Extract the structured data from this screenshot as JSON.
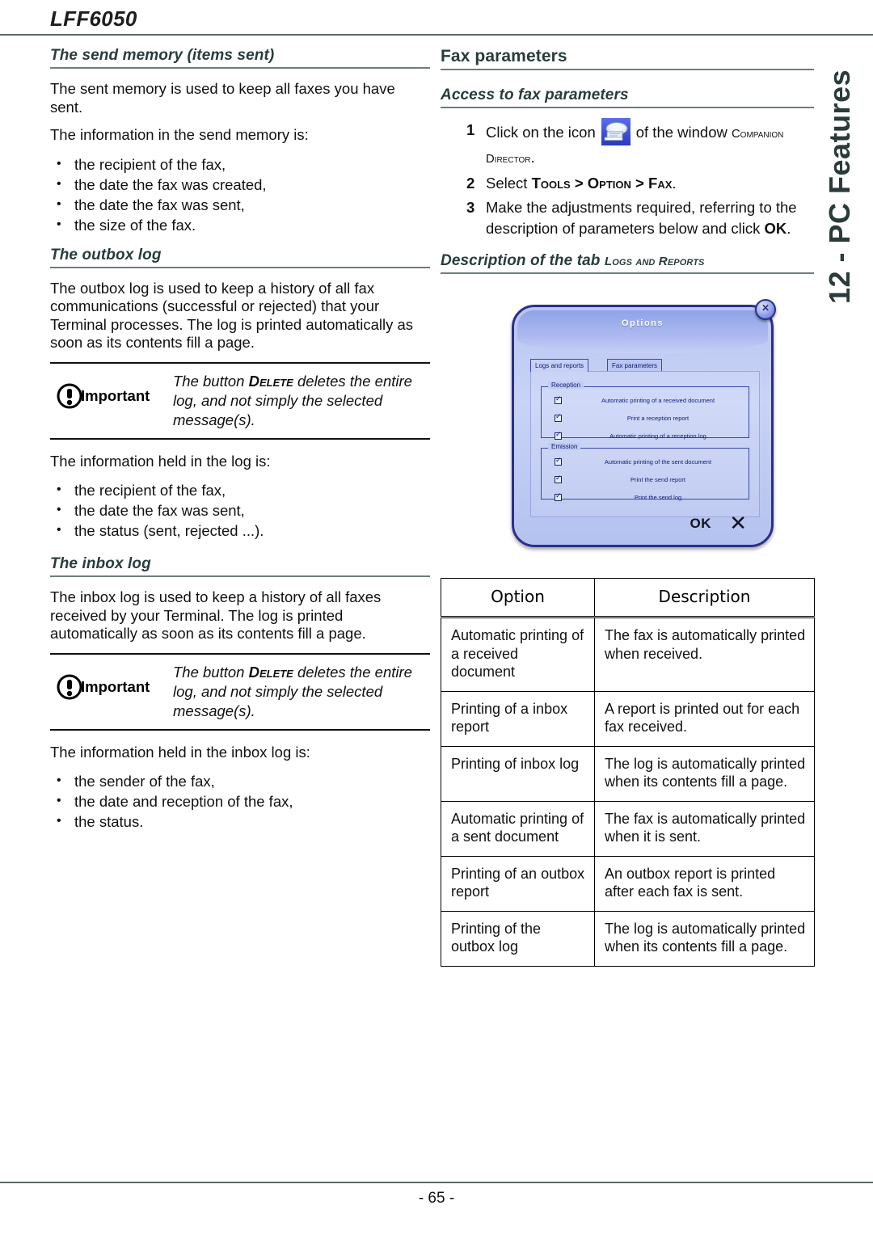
{
  "header": {
    "doc_title": "LFF6050",
    "vertical_tab": "12 - PC Features",
    "page_number": "- 65 -"
  },
  "left_column": {
    "send_memory": {
      "heading": "The send memory (items sent)",
      "intro": "The sent memory is used to keep all faxes you have sent.",
      "list_intro": "The information in the send memory is:",
      "bullets": [
        "the recipient of the fax,",
        "the date the fax was created,",
        "the date the fax was sent,",
        "the size of the fax."
      ]
    },
    "outbox_log": {
      "heading": "The outbox log",
      "intro": "The outbox log is used to keep a history of all fax communications (successful or rejected) that your Terminal processes. The log is printed automatically as soon as its contents fill a page.",
      "important": {
        "label": "Important",
        "text_before": "The button ",
        "text_keyword": "Delete",
        "text_after": " deletes the entire log, and not simply the selected message(s)."
      },
      "list_intro": "The information held in the log is:",
      "bullets": [
        "the recipient of the fax,",
        "the date the fax was sent,",
        "the status (sent, rejected ...)."
      ]
    },
    "inbox_log": {
      "heading": "The inbox log",
      "intro": "The inbox log is used to keep a history of all faxes received by your Terminal. The log is printed automatically as soon as its contents fill a page.",
      "important": {
        "label": "Important",
        "text_before": "The button ",
        "text_keyword": "Delete",
        "text_after": " deletes the entire log, and not simply the selected message(s)."
      },
      "list_intro": "The information held in the inbox log is:",
      "bullets": [
        "the sender of the fax,",
        "the date and reception of the fax,",
        "the status."
      ]
    }
  },
  "right_column": {
    "section_title": "Fax parameters",
    "access": {
      "heading": "Access to fax parameters",
      "steps": [
        {
          "num": "1",
          "part1": "Click on the icon",
          "icon": "fax-companion-icon",
          "part2": "of the window ",
          "smallcaps1": "Companion",
          "part3": " ",
          "smallcaps2": "Director",
          "part4": "."
        },
        {
          "num": "2",
          "part1": "Select ",
          "smallcaps1": "Tools",
          "sep1": " > ",
          "smallcaps2": "Option",
          "sep2": " > ",
          "smallcaps3": "Fax",
          "part4": "."
        },
        {
          "num": "3",
          "part1": "Make the adjustments required, referring to the description of parameters below and click ",
          "bold": "OK",
          "part4": "."
        }
      ]
    },
    "description_heading": {
      "prefix": "Description of the tab ",
      "smallcaps1": "Logs",
      "mid": " and ",
      "smallcaps2": "Reports"
    },
    "dialog": {
      "title": "Options",
      "close_icon": "close-icon",
      "tabs": [
        {
          "label": "Logs and reports",
          "active": true
        },
        {
          "label": "Fax parameters",
          "active": false
        }
      ],
      "groups": [
        {
          "legend": "Reception",
          "checkboxes": [
            {
              "label": "Automatic printing of a received document",
              "checked": true
            },
            {
              "label": "Print a reception report",
              "checked": true
            },
            {
              "label": "Automatic printing of a reception log",
              "checked": true
            }
          ]
        },
        {
          "legend": "Emission",
          "checkboxes": [
            {
              "label": "Automatic printing of the sent document",
              "checked": true
            },
            {
              "label": "Print the send report",
              "checked": true
            },
            {
              "label": "Print the send log",
              "checked": true
            }
          ]
        }
      ],
      "ok_label": "OK",
      "cancel_icon": "cancel-x-icon"
    },
    "options_table": {
      "columns": [
        "Option",
        "Description"
      ],
      "rows": [
        {
          "option": "Automatic printing of a received document",
          "description": "The fax is automatically printed when received."
        },
        {
          "option": "Printing of a inbox report",
          "description": "A report is printed out for each fax received."
        },
        {
          "option": "Printing of inbox log",
          "description": "The log is automatically printed when its contents fill a page."
        },
        {
          "option": "Automatic printing of a sent document",
          "description": "The fax is automatically printed when it is sent."
        },
        {
          "option": "Printing of an outbox report",
          "description": "An outbox report is printed after each fax is sent."
        },
        {
          "option": "Printing of the outbox log",
          "description": "The log is automatically printed when its contents fill a page."
        }
      ]
    }
  },
  "colors": {
    "heading": "#283c3c",
    "rule": "#6d7c7c",
    "dialog_border": "#2a2f8c",
    "dialog_bg": "#c0ccf5",
    "dialog_text": "#10207a"
  }
}
